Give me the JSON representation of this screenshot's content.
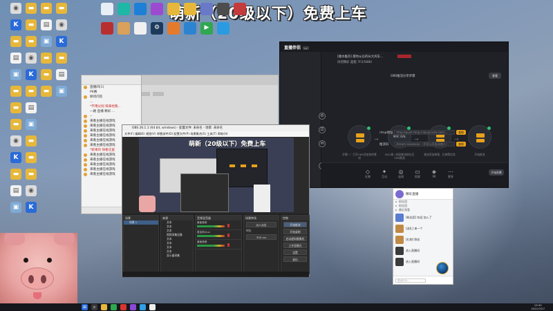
{
  "banner": {
    "text": "萌新（20级以下）免费上车"
  },
  "desktop_icons": [
    {
      "name": "mac-drive-icon",
      "label": "Mac",
      "color": "#dcdcdc"
    },
    {
      "name": "kuaishou-icon",
      "label": "",
      "color": "#2a6bd8"
    },
    {
      "name": "folder-icon",
      "label": "",
      "color": "#e6b73a"
    },
    {
      "name": "doc-icon",
      "label": "",
      "color": "#f2f2f2"
    },
    {
      "name": "computer-icon",
      "label": "",
      "color": "#7faad6"
    },
    {
      "name": "folder-icon",
      "label": "",
      "color": "#e6b73a"
    },
    {
      "name": "folder-icon",
      "label": "",
      "color": "#e6b73a"
    },
    {
      "name": "folder-icon",
      "label": "",
      "color": "#e6b73a"
    }
  ],
  "top_apps": [
    {
      "name": "recycle-icon",
      "color": "#e8eef5"
    },
    {
      "name": "teal-app-icon",
      "color": "#1fb7a6"
    },
    {
      "name": "edge-icon",
      "color": "#1e7fd6"
    },
    {
      "name": "game-icon",
      "color": "#9c4bd1"
    },
    {
      "name": "folder-icon",
      "color": "#e6b73a"
    },
    {
      "name": "folder-icon",
      "color": "#e6b73a"
    },
    {
      "name": "app-icon",
      "color": "#6a78c8"
    },
    {
      "name": "app-icon",
      "color": "#4d4d4d"
    },
    {
      "name": "game-icon",
      "color": "#c43b3b"
    },
    {
      "name": "game-icon",
      "color": "#b82f2f"
    },
    {
      "name": "dog-icon",
      "color": "#d9a15a"
    },
    {
      "name": "doc-icon",
      "color": "#f0f0f0"
    },
    {
      "name": "steam-icon",
      "color": "#1d3a5a"
    },
    {
      "name": "game-icon",
      "color": "#e67a2c"
    },
    {
      "name": "app-icon",
      "color": "#2c84d1"
    },
    {
      "name": "play-icon",
      "color": "#2fa84f"
    },
    {
      "name": "app-icon",
      "color": "#2a9be0"
    }
  ],
  "live_app": {
    "brand": "直播伴侣",
    "badge": "...",
    "title_row": "[顺水推舟] 愿你从兵的长大风车...",
    "subtitle_row": "风控精彩 超能 7F2/5880",
    "obs_line": "OBS推流分享步骤",
    "step_btn": "查看",
    "steps": [
      "步骤一：打开OBS添加你的素材",
      "MAC端 / 粘贴推流地址至OBS推流",
      "推流添加弹幕、礼物等信息",
      "开始推流"
    ],
    "circle_labels": [
      "",
      "MAC OAL",
      "",
      ""
    ],
    "rtmp_label": "rtmp地址",
    "rtmp_value": "rtmp://push-rtmp-l.douyincdn.com/...",
    "key_label": "推流码",
    "key_value": "stream-xxxxxxxx  （不可公开告诉他人）",
    "copy_label": "复制",
    "side_label": "工具箱",
    "bottom_items": [
      "礼物",
      "互动",
      "连线",
      "投屏",
      "PK",
      "更多"
    ],
    "start_btn": "开始直播"
  },
  "chat_small": {
    "rows": [
      {
        "text": "直播间(1)",
        "dot": true,
        "red": false
      },
      {
        "text": "PK赛",
        "dot": false,
        "red": false
      },
      {
        "text": "顾问问答",
        "dot": true,
        "red": false
      },
      {
        "text": "...",
        "dot": false,
        "red": false
      },
      {
        "text": "*不用分别 快来找我...",
        "dot": false,
        "red": true
      },
      {
        "text": "一路 直播 精彩 ...",
        "dot": false,
        "red": false
      },
      {
        "text": "--",
        "dot": true,
        "red": false
      },
      {
        "text": "来看主播在线游戏",
        "dot": true,
        "red": false
      },
      {
        "text": "来看主播在线游戏",
        "dot": true,
        "red": false
      },
      {
        "text": "来看主播在线游戏",
        "dot": true,
        "red": false
      },
      {
        "text": "来看主播在线游戏",
        "dot": true,
        "red": false
      },
      {
        "text": "来看主播在线游戏",
        "dot": true,
        "red": false
      },
      {
        "text": "来看主播在线游戏",
        "dot": true,
        "red": false
      },
      {
        "text": "*新来的 快看这里",
        "dot": false,
        "red": true
      },
      {
        "text": "来看主播在线游戏",
        "dot": true,
        "red": false
      },
      {
        "text": "来看主播在线游戏",
        "dot": true,
        "red": false
      },
      {
        "text": "来看主播在线游戏",
        "dot": true,
        "red": false
      },
      {
        "text": "来看主播在线游戏",
        "dot": true,
        "red": false
      },
      {
        "text": "来看主播在线游戏",
        "dot": true,
        "red": false
      }
    ]
  },
  "obs": {
    "title": "OBS 26.1.1 (64 bit, windows) - 配置文件: 未命名 - 场景: 未命名",
    "menu": "文件(F)  编辑(E)  视图(V)  停靠部件(D)  配置文件(P)  场景集合(S)  工具(T)  帮助(H)",
    "preview_banner": "萌新（20级以下）免费上车",
    "scenes_hdr": "场景",
    "scenes": [
      "场景 1"
    ],
    "sources_hdr": "来源",
    "sources": [
      "文本",
      "文本",
      "文本",
      "视频采集设备",
      "文本",
      "文本",
      "文本",
      "文本",
      "显示器采集"
    ],
    "mixer_hdr": "音频混音器",
    "mixer": [
      "桌面音频",
      "麦克风/Aux",
      "桌面音频"
    ],
    "transition_hdr": "场景转场",
    "transition_value": "淡入淡出",
    "duration_label": "时长",
    "duration_value": "300 ms",
    "controls_hdr": "控制",
    "controls": [
      "开始推流",
      "开始录制",
      "启动虚拟摄像机",
      "工作室模式",
      "设置",
      "退出"
    ]
  },
  "chat_panel": {
    "name": "精彩直播",
    "lines": [
      "粉丝团",
      "粉丝团",
      "最近观看"
    ],
    "messages": [
      {
        "text": "[粉丝团] 欢迎 加入了",
        "color": "#5a7dcf"
      },
      {
        "text": "[送礼] 来一个",
        "color": "#c08a45"
      },
      {
        "text": "[礼物] 鲜花",
        "color": "#c08a45"
      },
      {
        "text": "进入直播间",
        "color": "#3a3a3a"
      },
      {
        "text": "进入直播间",
        "color": "#3a3a3a"
      }
    ],
    "input_placeholder": "说点什么..."
  },
  "taskbar": {
    "time": "19:30",
    "date": "2021/7/27",
    "apps": [
      {
        "name": "start-icon",
        "color": "#2a6bd8"
      },
      {
        "name": "search-icon",
        "color": "#3a3a3a"
      },
      {
        "name": "folder-icon",
        "color": "#e6b73a"
      },
      {
        "name": "browser-icon",
        "color": "#2fa84f"
      },
      {
        "name": "app-icon",
        "color": "#d7352f"
      },
      {
        "name": "app-icon",
        "color": "#8b49d6"
      },
      {
        "name": "app-icon",
        "color": "#2e9fe6"
      },
      {
        "name": "app-icon",
        "color": "#eeeeee"
      }
    ]
  }
}
